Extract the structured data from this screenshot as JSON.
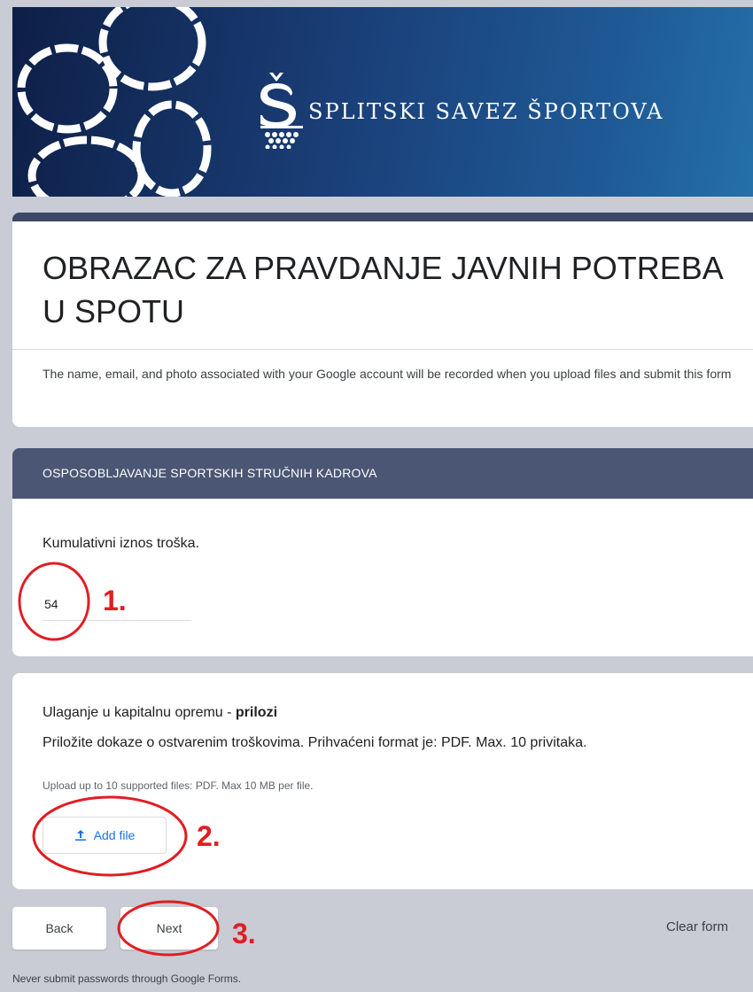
{
  "header": {
    "brand_name": "SPLITSKI SAVEZ ŠPORTOVA",
    "colors": {
      "banner_start": "#0e1f47",
      "banner_end": "#2470a8"
    }
  },
  "form": {
    "title": "OBRAZAC ZA PRAVDANJE JAVNIH POTREBA U SPOTU",
    "account_note": "The name, email, and photo associated with your Google account will be recorded when you upload files and submit this form"
  },
  "section": {
    "title": "OSPOSOBLJAVANJE SPORTSKIH STRUČNIH KADROVA"
  },
  "question1": {
    "label": "Kumulativni iznos troška.",
    "value": "54"
  },
  "question2": {
    "label_prefix": "Ulaganje u kapitalnu opremu - ",
    "label_bold": "prilozi",
    "description": "Priložite dokaze o ostvarenim troškovima. Prihvaćeni format je: PDF. Max. 10 privitaka.",
    "upload_hint": "Upload up to 10 supported files: PDF. Max 10 MB per file.",
    "add_file_label": "Add file",
    "add_file_icon": "upload-icon"
  },
  "navigation": {
    "back_label": "Back",
    "next_label": "Next",
    "clear_label": "Clear form"
  },
  "footer": {
    "note": "Never submit passwords through Google Forms."
  },
  "annotations": {
    "color": "#e11d22",
    "labels": [
      "1.",
      "2.",
      "3."
    ]
  }
}
